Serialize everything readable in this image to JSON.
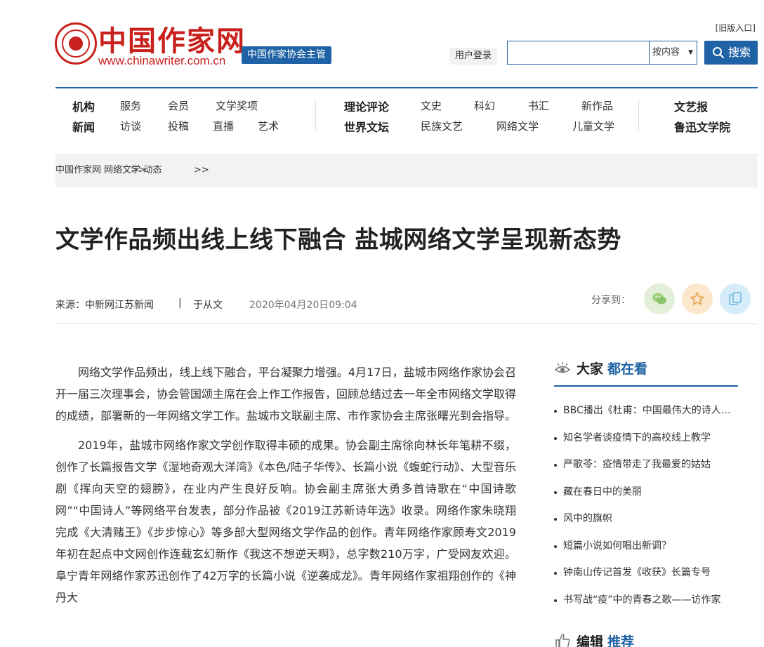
{
  "header": {
    "logo_title": "中国作家网",
    "logo_url": "www.chinawriter.com.cn",
    "badge": "中国作家协会主管",
    "old_version": "[旧版入口]",
    "login": "用户登录",
    "search": {
      "placeholder": "",
      "scope": "按内容",
      "button": "搜索"
    }
  },
  "nav": {
    "row1": [
      "机构",
      "服务",
      "会员",
      "文学奖项",
      "理论评论",
      "文史",
      "科幻",
      "书汇",
      "新作品",
      "文艺报"
    ],
    "row2": [
      "新闻",
      "访谈",
      "投稿",
      "直播",
      "艺术",
      "世界文坛",
      "民族文艺",
      "网络文学",
      "儿童文学",
      "鲁迅文学院"
    ]
  },
  "breadcrumb": {
    "items": [
      "中国作家网",
      "网络文学",
      "动态"
    ],
    "separator": ">>"
  },
  "article": {
    "title": "文学作品频出线上线下融合 盐城网络文学呈现新态势",
    "source": "来源：中新网江苏新闻",
    "separator": "|",
    "author": "于从文",
    "time": "2020年04月20日09:04",
    "share_label": "分享到：",
    "paragraphs": [
      "网络文学作品频出，线上线下融合，平台凝聚力增强。4月17日，盐城市网络作家协会召开一届三次理事会，协会管国颂主席在会上作工作报告，回顾总结过去一年全市网络文学取得的成绩，部署新的一年网络文学工作。盐城市文联副主席、市作家协会主席张曙光到会指导。",
      "2019年，盐城市网络作家文学创作取得丰硕的成果。协会副主席徐向林长年笔耕不缀，创作了长篇报告文学《湿地奇观大洋湾》《本色/陆子华传》、长篇小说《蝮蛇行动》、大型音乐剧《挥向天空的翅膀》，在业内产生良好反响。协会副主席张大勇多首诗歌在“中国诗歌网”“中国诗人”等网络平台发表，部分作品被《2019江苏新诗年选》收录。网络作家朱晓翔完成《大清赌王》《步步惊心》等多部大型网络文学作品的创作。青年网络作家顾寿文2019年初在起点中文网创作连载玄幻新作《我这不想逆天啊》，总字数210万字，广受网友欢迎。阜宁青年网络作家苏迅创作了42万字的长篇小说《逆袭成龙》。青年网络作家祖翔创作的《神丹大"
    ]
  },
  "sidebar": {
    "section1_title_a": "大家",
    "section1_title_b": "都在看",
    "items": [
      "BBC播出《杜甫：中国最伟大的诗人》纪录片",
      "知名学者谈疫情下的高校线上教学",
      "严歌苓：疫情带走了我最爱的姑姑",
      "藏在春日中的美丽",
      "风中的旗帜",
      "短篇小说如何唱出新调？",
      "钟南山传记首发《收获》长篇专号",
      "书写战“疫”中的青春之歌——访作家"
    ],
    "section2_title_a": "编辑",
    "section2_title_b": "推荐"
  },
  "colors": {
    "brand_red": "#c8201c",
    "brand_blue": "#1f62a5",
    "wechat_bg": "#e3efd9",
    "favorite_bg": "#fbe7cc",
    "copy_bg": "#d6ecf8"
  },
  "icons": [
    "search-icon",
    "wechat-icon",
    "star-icon",
    "copy-icon",
    "eye-icon",
    "thumbs-up-icon"
  ]
}
